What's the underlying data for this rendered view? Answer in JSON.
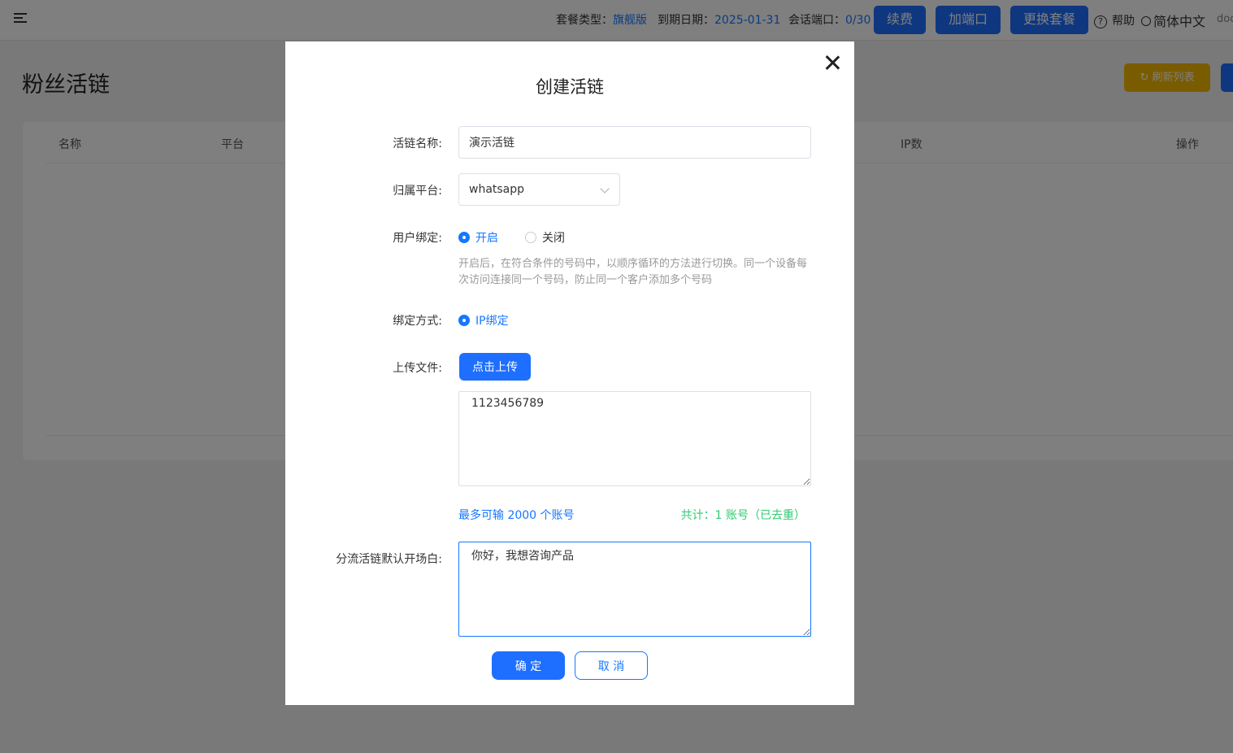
{
  "topbar": {
    "plan_label": "套餐类型：",
    "plan_value": "旗舰版",
    "expiry_label": "到期日期：",
    "expiry_value": "2025-01-31",
    "port_label": "会话端口：",
    "port_value": "0/30",
    "renew_btn": "续费",
    "add_port_btn": "加端口",
    "change_plan_btn": "更换套餐",
    "help": "帮助",
    "language": "简体中文",
    "doc": "doc"
  },
  "page": {
    "title": "粉丝活链",
    "refresh_btn": "刷新列表",
    "columns": [
      "名称",
      "平台",
      "IP数",
      "操作"
    ]
  },
  "modal": {
    "title": "创建活链",
    "name_label": "活链名称:",
    "name_value": "演示活链",
    "platform_label": "归属平台:",
    "platform_value": "whatsapp",
    "binding_label": "用户绑定:",
    "binding_on": "开启",
    "binding_off": "关闭",
    "hint": "开启后，在符合条件的号码中，以顺序循环的方法进行切换。同一个设备每次访问连接同一个号码，防止同一个客户添加多个号码",
    "bind_mode_label": "绑定方式:",
    "bind_mode_ip": "IP绑定",
    "upload_label": "上传文件:",
    "upload_btn": "点击上传",
    "numbers_value": "1123456789",
    "max_note": "最多可输 2000 个账号",
    "count_note": "共计：1 账号（已去重）",
    "greeting_label": "分流活链默认开场白:",
    "greeting_value": "你好，我想咨询产品",
    "ok_btn": "确 定",
    "cancel_btn": "取 消"
  },
  "colors": {
    "primary": "#1e6fff",
    "link": "#1677ff",
    "success": "#2ecc71",
    "warning": "#f5b900"
  },
  "icons": [
    "menu-toggle-icon",
    "help-icon",
    "user-icon",
    "close-icon",
    "chevron-down-icon",
    "refresh-icon"
  ]
}
